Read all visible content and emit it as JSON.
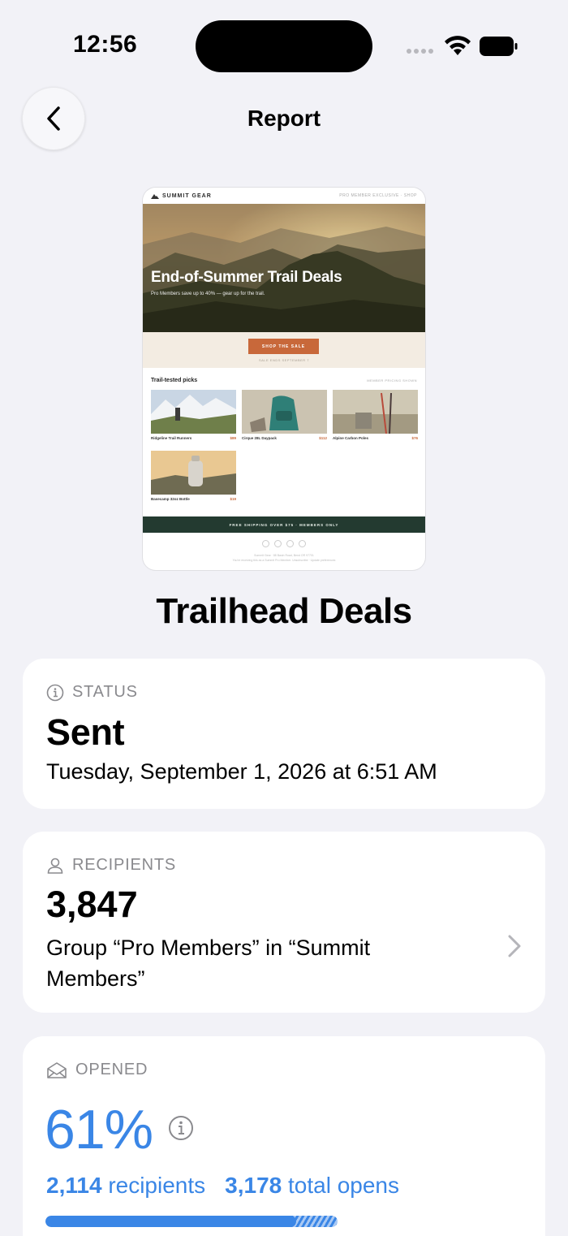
{
  "status_bar": {
    "time": "12:56"
  },
  "nav": {
    "title": "Report"
  },
  "preview": {
    "brand": "SUMMIT GEAR",
    "top_links": "PRO MEMBER EXCLUSIVE · SHOP",
    "hero_title": "End-of-Summer Trail Deals",
    "hero_sub": "Pro Members save up to 40% — gear up for the trail.",
    "cta": "SHOP THE SALE",
    "cta_sub": "SALE ENDS SEPTEMBER 7",
    "picks_title": "Trail-tested picks",
    "picks_link": "MEMBER PRICING SHOWN",
    "products": [
      {
        "name": "Ridgeline Trail Runners",
        "price": "$89"
      },
      {
        "name": "Cirque 28L Daypack",
        "price": "$112"
      },
      {
        "name": "Alpine Carbon Poles",
        "price": "$76"
      },
      {
        "name": "Basecamp 32oz Bottle",
        "price": "$19"
      }
    ],
    "footer_bar": "FREE SHIPPING OVER $75 · MEMBERS ONLY",
    "fine_print_1": "Summit Gear · 88 Basin Road, Bend OR 97701",
    "fine_print_2": "You're receiving this as a Summit Pro Member. Unsubscribe · Update preferences"
  },
  "campaign": {
    "title": "Trailhead Deals"
  },
  "status_card": {
    "label": "STATUS",
    "value": "Sent",
    "date": "Tuesday, September 1, 2026 at 6:51 AM"
  },
  "recipients_card": {
    "label": "RECIPIENTS",
    "value": "3,847",
    "group": "Group “Pro Members” in “Summit Members”"
  },
  "opened_card": {
    "label": "OPENED",
    "percent": "61%",
    "recipients_count": "2,114",
    "recipients_word": "recipients",
    "total_opens_count": "3,178",
    "total_opens_word": "total opens",
    "progress_fraction": 0.61,
    "hatch_fraction": 0.1,
    "accent": "#3a86e6"
  }
}
